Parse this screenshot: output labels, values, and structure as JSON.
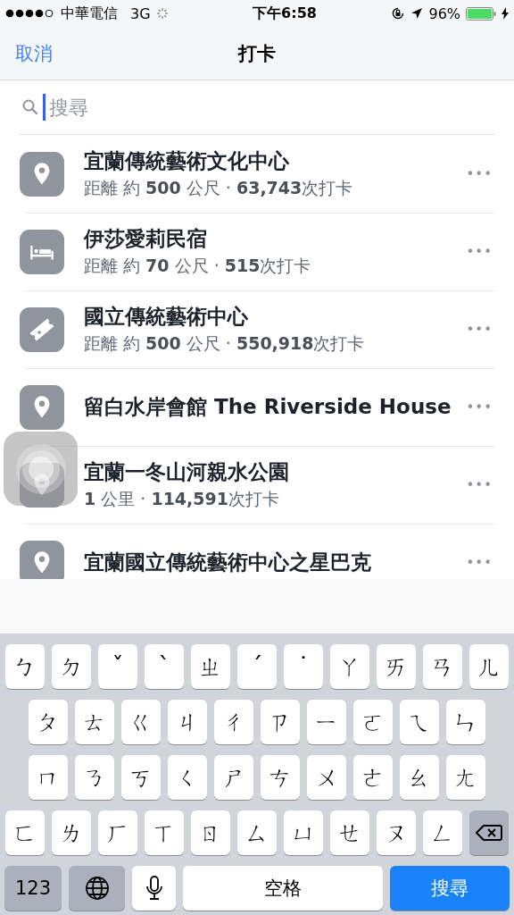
{
  "status_bar": {
    "carrier": "中華電信",
    "network": "3G",
    "time": "下午6:58",
    "battery": "96%"
  },
  "nav": {
    "cancel": "取消",
    "title": "打卡"
  },
  "search": {
    "placeholder": "搜尋"
  },
  "places": [
    {
      "kind": "pin",
      "name": "宜蘭傳統藝術文化中心",
      "detail": "距離 約 **500** 公尺 · **63,743**次打卡",
      "more": "•••"
    },
    {
      "kind": "bed",
      "name": "伊莎愛莉民宿",
      "detail": "距離 約 **70** 公尺 · **515**次打卡",
      "more": "•••"
    },
    {
      "kind": "ticket",
      "name": "國立傳統藝術中心",
      "detail": "距離 約 **500** 公尺 · **550,918**次打卡",
      "more": "•••"
    },
    {
      "kind": "pin",
      "name": "留白水岸會館 The Riverside House",
      "more": "•••"
    },
    {
      "kind": "pin",
      "name": "宜蘭一冬山河親水公園",
      "detail": "**1** 公里 · **114,591**次打卡",
      "more": "•••"
    },
    {
      "kind": "pin",
      "name": "宜蘭國立傳統藝術中心之星巴克",
      "more": "•••"
    }
  ],
  "keyboard": {
    "rows": [
      [
        "ㄅ",
        "ㄉ",
        "ˇ",
        "ˋ",
        "ㄓ",
        "ˊ",
        "˙",
        "ㄚ",
        "ㄞ",
        "ㄢ",
        "ㄦ"
      ],
      [
        "ㄆ",
        "ㄊ",
        "ㄍ",
        "ㄐ",
        "ㄔ",
        "ㄗ",
        "ㄧ",
        "ㄛ",
        "ㄟ",
        "ㄣ"
      ],
      [
        "ㄇ",
        "ㄋ",
        "ㄎ",
        "ㄑ",
        "ㄕ",
        "ㄘ",
        "ㄨ",
        "ㄜ",
        "ㄠ",
        "ㄤ"
      ],
      [
        "ㄈ",
        "ㄌ",
        "ㄏ",
        "ㄒ",
        "ㄖ",
        "ㄙ",
        "ㄩ",
        "ㄝ",
        "ㄡ",
        "ㄥ"
      ]
    ],
    "numbers": "123",
    "space": "空格",
    "search": "搜尋"
  }
}
